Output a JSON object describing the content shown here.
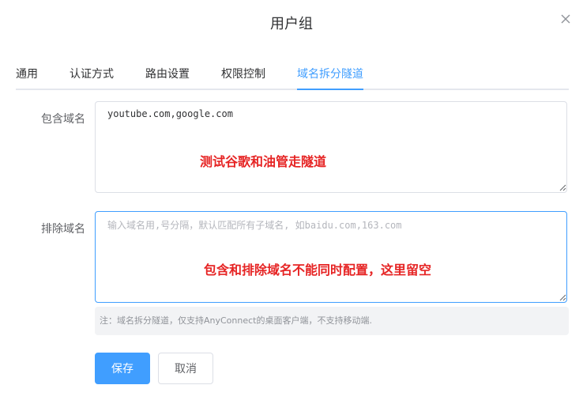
{
  "dialog": {
    "title": "用户组"
  },
  "tabs": [
    {
      "label": "通用"
    },
    {
      "label": "认证方式"
    },
    {
      "label": "路由设置"
    },
    {
      "label": "权限控制"
    },
    {
      "label": "域名拆分隧道"
    }
  ],
  "form": {
    "include": {
      "label": "包含域名",
      "value": "youtube.com,google.com",
      "annotation": "测试谷歌和油管走隧道"
    },
    "exclude": {
      "label": "排除域名",
      "value": "",
      "placeholder": "输入域名用,号分隔，默认匹配所有子域名, 如baidu.com,163.com",
      "annotation": "包含和排除域名不能同时配置，这里留空"
    },
    "note": "注：域名拆分隧道，仅支持AnyConnect的桌面客户端，不支持移动端."
  },
  "buttons": {
    "save_label": "保存",
    "cancel_label": "取消"
  },
  "colors": {
    "accent": "#409eff",
    "annotation": "#e62424",
    "border": "#dcdfe6",
    "note_bg": "#f2f3f5"
  },
  "icons": {
    "close": "close-icon",
    "resize": "resize-grip-icon"
  }
}
